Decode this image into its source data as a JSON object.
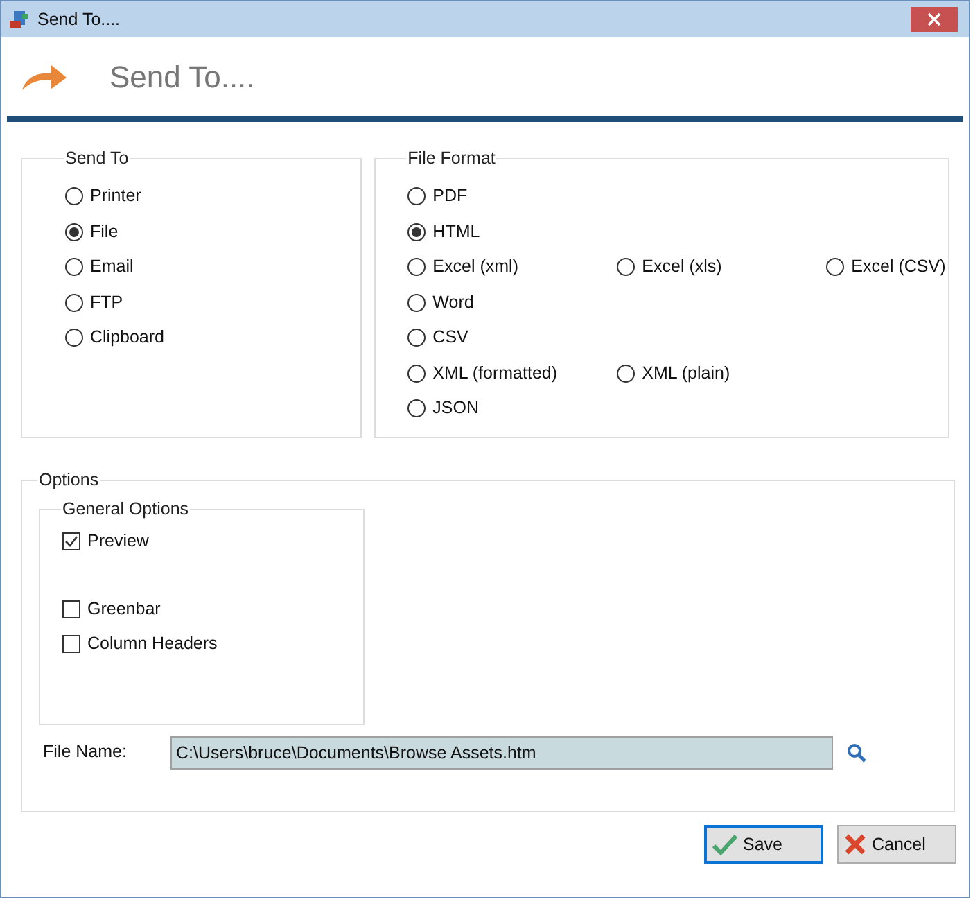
{
  "window": {
    "title": "Send To...."
  },
  "header": {
    "title": "Send To...."
  },
  "send_to": {
    "title": "Send To",
    "options": [
      {
        "label": "Printer",
        "selected": false
      },
      {
        "label": "File",
        "selected": true
      },
      {
        "label": "Email",
        "selected": false
      },
      {
        "label": "FTP",
        "selected": false
      },
      {
        "label": "Clipboard",
        "selected": false
      }
    ]
  },
  "file_format": {
    "title": "File Format",
    "rows": [
      [
        {
          "label": "PDF",
          "selected": false
        }
      ],
      [
        {
          "label": "HTML",
          "selected": true
        }
      ],
      [
        {
          "label": "Excel (xml)",
          "selected": false
        },
        {
          "label": "Excel (xls)",
          "selected": false
        },
        {
          "label": "Excel (CSV)",
          "selected": false
        }
      ],
      [
        {
          "label": "Word",
          "selected": false
        }
      ],
      [
        {
          "label": "CSV",
          "selected": false
        }
      ],
      [
        {
          "label": "XML (formatted)",
          "selected": false
        },
        {
          "label": "XML (plain)",
          "selected": false
        }
      ],
      [
        {
          "label": "JSON",
          "selected": false
        }
      ]
    ]
  },
  "options": {
    "title": "Options",
    "general": {
      "title": "General Options",
      "items": [
        {
          "label": "Preview",
          "checked": true
        },
        {
          "label": "Greenbar",
          "checked": false
        },
        {
          "label": "Column Headers",
          "checked": false
        }
      ]
    },
    "file_name": {
      "label": "File Name:",
      "value": "C:\\Users\\bruce\\Documents\\Browse Assets.htm"
    }
  },
  "buttons": [
    {
      "kind": "save",
      "label": "Save",
      "focused": true
    },
    {
      "kind": "cancel",
      "label": "Cancel",
      "focused": false
    }
  ]
}
